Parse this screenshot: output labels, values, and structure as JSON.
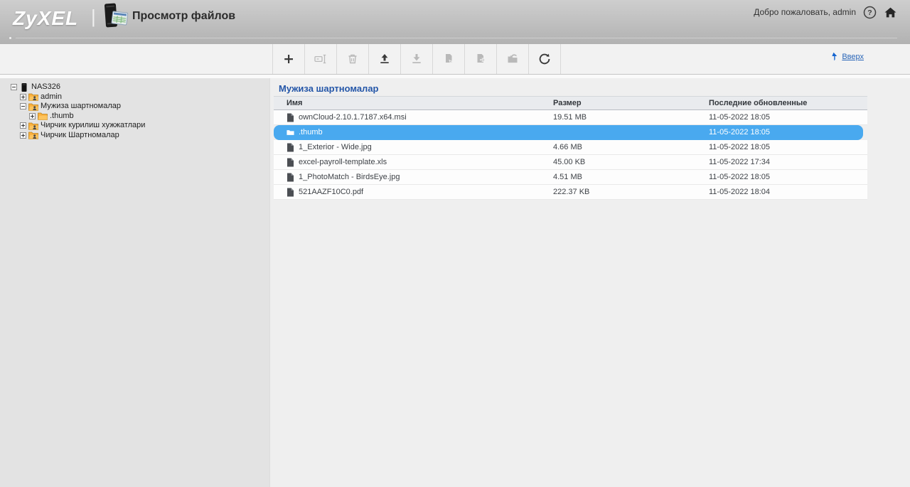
{
  "header": {
    "logo": "ZyXEL",
    "logo_separator": "|",
    "app_title": "Просмотр файлов",
    "welcome_text": "Добро пожаловать, admin"
  },
  "toolbar": {
    "buttons": [
      {
        "icon": "add",
        "enabled": true
      },
      {
        "icon": "rename",
        "enabled": false
      },
      {
        "icon": "delete",
        "enabled": false
      },
      {
        "icon": "upload",
        "enabled": true
      },
      {
        "icon": "download",
        "enabled": false
      },
      {
        "icon": "copy",
        "enabled": false
      },
      {
        "icon": "move",
        "enabled": false
      },
      {
        "icon": "share",
        "enabled": false
      },
      {
        "icon": "refresh",
        "enabled": true
      }
    ],
    "up_label": "Вверх"
  },
  "sidebar": {
    "tree": [
      {
        "label": "NAS326",
        "depth": 0,
        "expander": "minus",
        "icon": "nas"
      },
      {
        "label": "admin",
        "depth": 1,
        "expander": "plus",
        "icon": "shared-folder"
      },
      {
        "label": "Мужиза шартномалар",
        "depth": 1,
        "expander": "minus",
        "icon": "shared-folder"
      },
      {
        "label": ".thumb",
        "depth": 2,
        "expander": "plus",
        "icon": "folder"
      },
      {
        "label": "Чирчик курилиш хужжатлари",
        "depth": 1,
        "expander": "plus",
        "icon": "shared-folder"
      },
      {
        "label": "Чирчик Шартномалар",
        "depth": 1,
        "expander": "plus",
        "icon": "shared-folder"
      }
    ]
  },
  "main": {
    "heading": "Мужиза шартномалар",
    "table": {
      "columns": [
        "Имя",
        "Размер",
        "Последние обновленные"
      ],
      "rows": [
        {
          "name": "ownCloud-2.10.1.7187.x64.msi",
          "type": "file",
          "size": "19.51 MB",
          "updated": "11-05-2022 18:05",
          "selected": false
        },
        {
          "name": ".thumb",
          "type": "folder",
          "size": "",
          "updated": "11-05-2022 18:05",
          "selected": true
        },
        {
          "name": "1_Exterior - Wide.jpg",
          "type": "file",
          "size": "4.66 MB",
          "updated": "11-05-2022 18:05",
          "selected": false
        },
        {
          "name": "excel-payroll-template.xls",
          "type": "file",
          "size": "45.00 KB",
          "updated": "11-05-2022 17:34",
          "selected": false
        },
        {
          "name": "1_PhotoMatch - BirdsEye.jpg",
          "type": "file",
          "size": "4.51 MB",
          "updated": "11-05-2022 18:05",
          "selected": false
        },
        {
          "name": "521AAZF10C0.pdf",
          "type": "file",
          "size": "222.37 KB",
          "updated": "11-05-2022 18:04",
          "selected": false
        }
      ]
    }
  },
  "colors": {
    "selection_blue": "#49a9ef",
    "heading_blue": "#2456a8",
    "link_blue": "#2a66b8",
    "folder_orange": "#fbb03b",
    "header_gray": "#b8b8b8"
  }
}
